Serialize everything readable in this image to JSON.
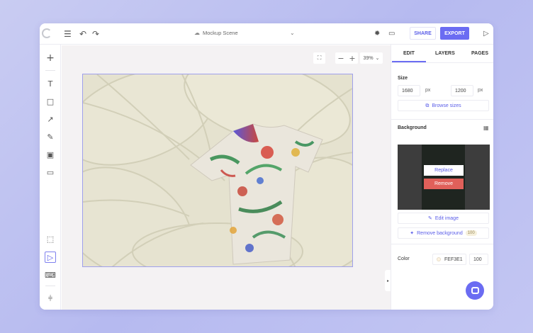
{
  "topbar": {
    "doc_title": "Mockup Scene",
    "share_label": "SHARE",
    "export_label": "EXPORT",
    "icons": [
      "menu-icon",
      "undo-icon",
      "redo-icon",
      "cloud-icon",
      "chevron-down-icon",
      "sun-icon",
      "comment-icon",
      "play-icon"
    ]
  },
  "toolbar": {
    "icons": [
      "plus-icon",
      "text-icon",
      "shape-icon",
      "arrow-icon",
      "pen-icon",
      "image-icon",
      "device-icon",
      "frame-icon",
      "select-icon",
      "keyboard-icon",
      "adjust-icon"
    ]
  },
  "canvas": {
    "zoom_minus": "−",
    "zoom_plus": "+",
    "zoom_level": "39%"
  },
  "panel": {
    "tabs": [
      "EDIT",
      "LAYERS",
      "PAGES"
    ],
    "size_title": "Size",
    "width_value": "1680",
    "height_value": "1200",
    "unit": "px",
    "browse_sizes": "Browse sizes",
    "background_title": "Background",
    "replace_label": "Replace",
    "remove_label": "Remove",
    "edit_image": "Edit image",
    "remove_background": "Remove background",
    "remove_bg_badge": "100",
    "color_title": "Color",
    "color_hex": "FEF3E1",
    "color_opacity": "100"
  },
  "colors": {
    "accent": "#6b6cf2",
    "remove_button": "#e0605a",
    "artboard_bg": "#e5e2cf",
    "swatch": "#FEF3E1"
  }
}
